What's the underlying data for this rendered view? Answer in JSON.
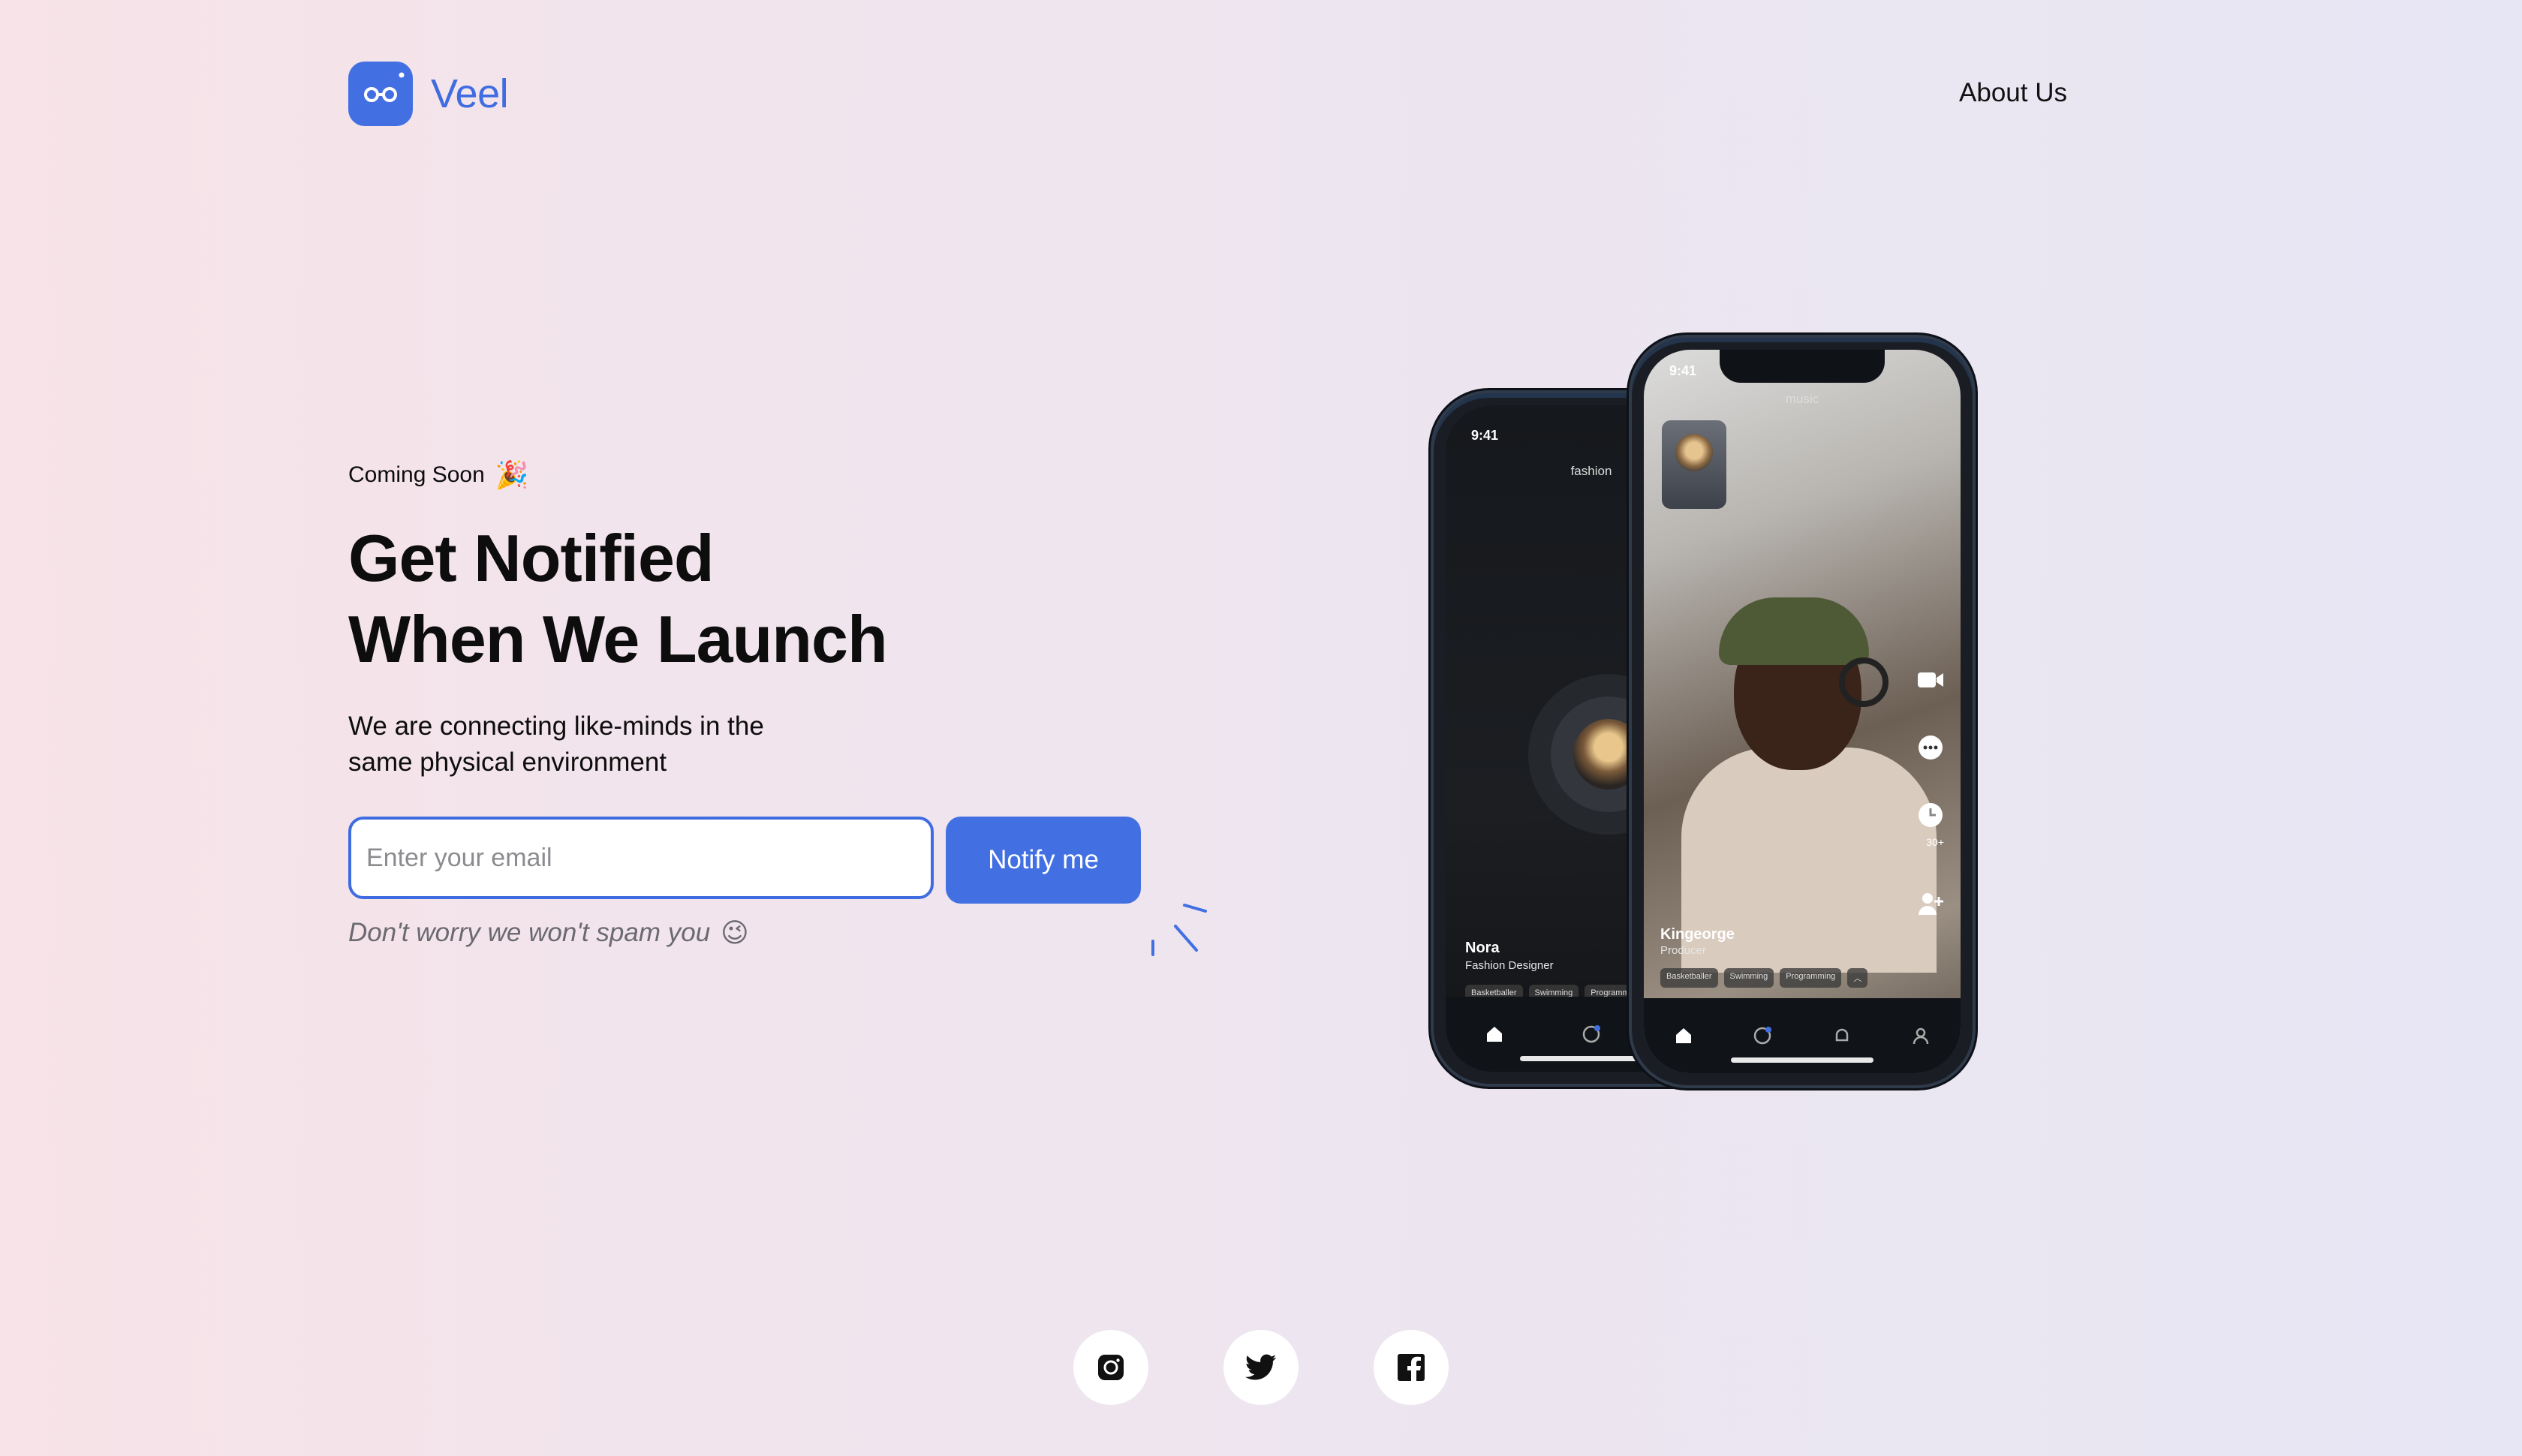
{
  "brand": {
    "name": "Veel",
    "logo_icon": "glasses-icon",
    "accent": "#4270e3"
  },
  "nav": {
    "about": "About Us"
  },
  "hero": {
    "eyebrow": "Coming Soon",
    "eyebrow_emoji": "🎉",
    "headline_line1": "Get Notified",
    "headline_line2": "When We Launch",
    "subtext_line1": "We are connecting like-minds in the",
    "subtext_line2": "same physical environment"
  },
  "form": {
    "email_placeholder": "Enter your email",
    "email_value": "",
    "submit_label": "Notify me",
    "note": "Don't worry we won't spam you",
    "note_emoji": "😉"
  },
  "phones": {
    "back": {
      "time": "9:41",
      "category": "fashion",
      "user_name": "Nora",
      "user_role": "Fashion Designer",
      "tags": [
        "Basketballer",
        "Swimming",
        "Programming"
      ]
    },
    "front": {
      "time": "9:41",
      "category": "music",
      "user_name": "Kingeorge",
      "user_role": "Producer",
      "tags": [
        "Basketballer",
        "Swimming",
        "Programming"
      ],
      "timer_count": "30+"
    }
  },
  "socials": [
    "instagram-icon",
    "twitter-icon",
    "facebook-icon"
  ]
}
